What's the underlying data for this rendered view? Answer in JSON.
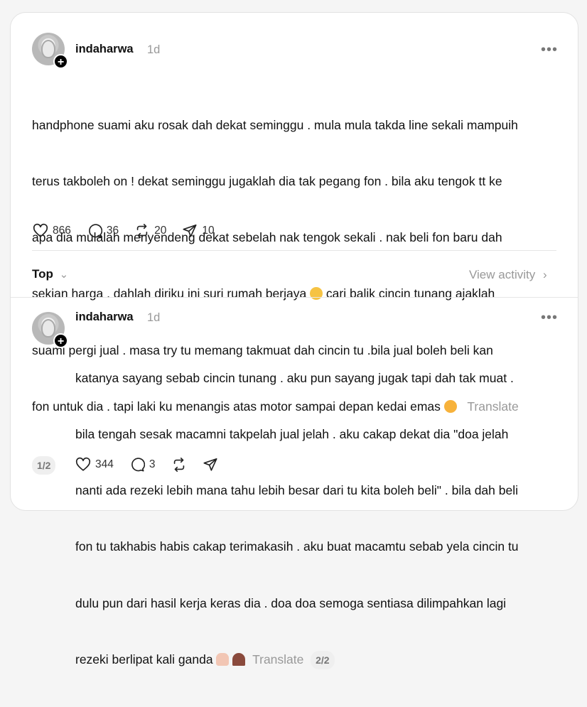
{
  "post1": {
    "username": "indaharwa",
    "time": "1d",
    "lines": [
      "handphone suami aku rosak dah dekat seminggu . mula mula takda line sekali mampuih",
      "terus takboleh on ! dekat seminggu jugaklah dia tak pegang fon . bila aku tengok tt ke",
      "apa dia mulalah menyendeng dekat sebelah nak tengok sekali . nak beli fon baru dah",
      "sekian harga . dahlah diriku ini suri rumah berjaya",
      " cari balik cincin tunang ajaklah",
      "suami pergi jual . masa try tu memang takmuat dah cincin tu .bila jual boleh beli kan",
      "fon untuk dia . tapi laki ku menangis atas motor sampai depan kedai emas"
    ],
    "translate": "Translate",
    "pager": "1/2",
    "likes": "866",
    "comments": "36",
    "reposts": "20",
    "shares": "10",
    "emoji_crying_color": "#f6c343",
    "emoji_pleading_color": "#f7b23b"
  },
  "sort": {
    "label": "Top"
  },
  "view_activity": "View activity",
  "post2": {
    "username": "indaharwa",
    "time": "1d",
    "lines": [
      "katanya sayang sebab cincin tunang . aku pun sayang jugak tapi dah tak muat .",
      "bila tengah sesak macamni takpelah jual jelah . aku cakap dekat dia \"doa jelah",
      "nanti ada rezeki lebih mana tahu lebih besar dari tu kita boleh beli\" . bila dah beli",
      "fon tu takhabis habis cakap terimakasih . aku buat macamtu sebab yela cincin tu",
      "dulu pun dari hasil kerja keras dia . doa doa semoga sentiasa dilimpahkan lagi",
      "rezeki berlipat kali ganda"
    ],
    "translate": "Translate",
    "pager": "2/2",
    "likes": "344",
    "comments": "3",
    "emoji_hands_color": "#f2c6b4",
    "emoji_heart_color": "#8a4a3c"
  },
  "icons": {
    "avatar_plus": "+",
    "more": "•••",
    "chevron_down": "⌄",
    "chevron_right": "›"
  }
}
